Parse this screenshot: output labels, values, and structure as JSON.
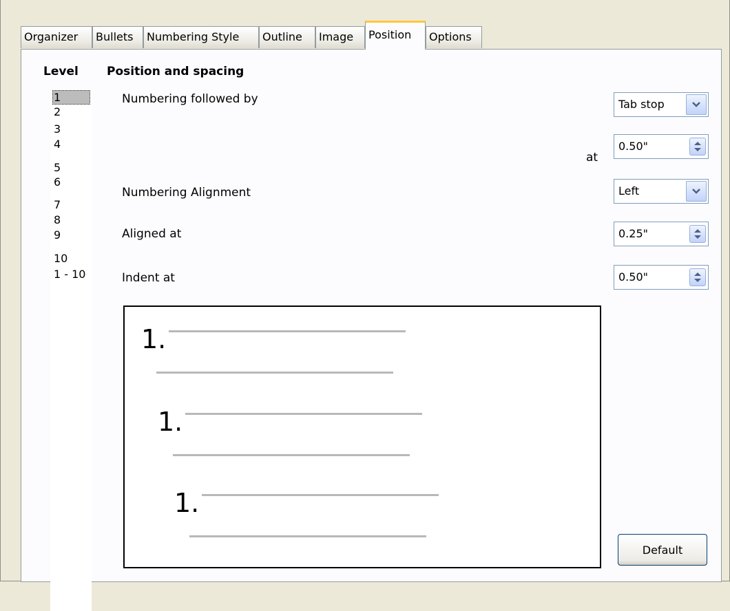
{
  "tabs": [
    {
      "label": "Organizer"
    },
    {
      "label": "Bullets"
    },
    {
      "label": "Numbering Style"
    },
    {
      "label": "Outline"
    },
    {
      "label": "Image"
    },
    {
      "label": "Position",
      "active": true
    },
    {
      "label": "Options"
    }
  ],
  "level": {
    "title": "Level",
    "items": [
      "1",
      "2",
      "3",
      "4",
      "5",
      "6",
      "7",
      "8",
      "9",
      "10",
      "1 - 10"
    ],
    "selected": "1"
  },
  "position": {
    "title": "Position and spacing",
    "numbering_followed_by": {
      "label": "Numbering followed by",
      "value": "Tab stop"
    },
    "at": {
      "label": "at",
      "value": "0.50\""
    },
    "numbering_alignment": {
      "label": "Numbering Alignment",
      "value": "Left"
    },
    "aligned_at": {
      "label": "Aligned at",
      "value": "0.25\""
    },
    "indent_at": {
      "label": "Indent at",
      "value": "0.50\""
    }
  },
  "preview": {
    "numbers": [
      "1.",
      "1.",
      "1."
    ]
  },
  "default_button": {
    "label": "Default"
  },
  "colors": {
    "active_tab_accent": "#ffc83c",
    "dialog_bg": "#ECE9D8",
    "panel_bg": "#fcfcfe"
  }
}
